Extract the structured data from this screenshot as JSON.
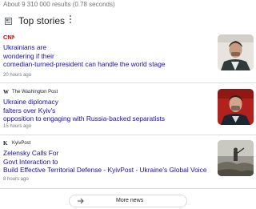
{
  "results": {
    "count_text": "About 9 310 000 results (0.78 seconds)"
  },
  "top_stories": {
    "title": "Top stories",
    "stories": [
      {
        "source": "CNN",
        "headline_lines": [
          "Ukrainians are",
          "wondering if their",
          "comedian-turned-president can handle the world stage"
        ],
        "time": "20 hours ago"
      },
      {
        "source": "The Washington Post",
        "headline_lines": [
          "Ukraine diplomacy",
          "falters over Kyiv's",
          "opposition to engaging with Russia-backed separatists"
        ],
        "time": "15 hours ago"
      },
      {
        "source": "KyivPost",
        "headline_lines": [
          "Zelensky Calls For",
          "Govt Interaction to",
          "Build Effective Territorial Defense - KyivPost - Ukraine's Global Voice"
        ],
        "time": "8 hours ago"
      }
    ],
    "more_button": "More news"
  },
  "colors": {
    "link": "#1a0dab",
    "meta": "#70757a",
    "divider": "#dadce0",
    "cnn_red": "#cc0000"
  },
  "icons": {
    "header": "newspaper-icon",
    "menu": "more-vert-icon",
    "more": "arrow-right-icon"
  }
}
